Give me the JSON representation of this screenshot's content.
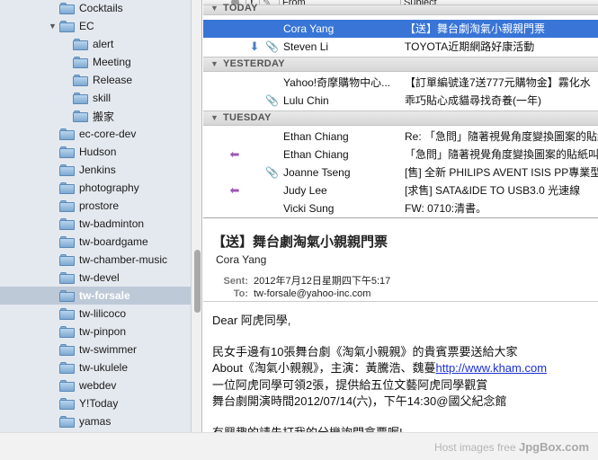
{
  "sidebar": {
    "folders": [
      {
        "label": "Cocktails"
      },
      {
        "label": "EC"
      },
      {
        "label": "alert"
      },
      {
        "label": "Meeting"
      },
      {
        "label": "Release"
      },
      {
        "label": "skill"
      },
      {
        "label": "搬家"
      },
      {
        "label": "ec-core-dev"
      },
      {
        "label": "Hudson"
      },
      {
        "label": "Jenkins"
      },
      {
        "label": "photography"
      },
      {
        "label": "prostore"
      },
      {
        "label": "tw-badminton"
      },
      {
        "label": "tw-boardgame"
      },
      {
        "label": "tw-chamber-music"
      },
      {
        "label": "tw-devel"
      },
      {
        "label": "tw-forsale"
      },
      {
        "label": "tw-lilicoco"
      },
      {
        "label": "tw-pinpon"
      },
      {
        "label": "tw-swimmer"
      },
      {
        "label": "tw-ukulele"
      },
      {
        "label": "webdev"
      },
      {
        "label": "Y!Today"
      },
      {
        "label": "yamas"
      }
    ]
  },
  "message_list": {
    "columns": {
      "from": "From",
      "subject": "Subject",
      "flag": "!"
    },
    "groups": [
      {
        "label": "TODAY"
      },
      {
        "label": "YESTERDAY"
      },
      {
        "label": "TUESDAY"
      }
    ],
    "rows": [
      {
        "from": "Cora Yang",
        "subject": "【送】舞台劇淘氣小親親門票"
      },
      {
        "from": "Steven Li",
        "subject": "TOYOTA近期網路好康活動"
      },
      {
        "from": "Yahoo!奇摩購物中心...",
        "subject": "【訂單編號逢7送777元購物金】霧化水"
      },
      {
        "from": "Lulu Chin",
        "subject": "乖巧貼心成貓尋找奇養(一年)"
      },
      {
        "from": "Ethan Chiang",
        "subject": "Re: 「急問」隨著視覺角度變換圖案的貼紙"
      },
      {
        "from": "Ethan Chiang",
        "subject": "「急問」隨著視覺角度變換圖案的貼紙叫"
      },
      {
        "from": "Joanne Tseng",
        "subject": "[售] 全新 PHILIPS AVENT ISIS PP專業型"
      },
      {
        "from": "Judy Lee",
        "subject": "[求售] SATA&IDE TO USB3.0 光速線"
      },
      {
        "from": "Vicki Sung",
        "subject": "FW: 0710:清書。"
      }
    ]
  },
  "preview": {
    "subject": "【送】舞台劇淘氣小親親門票",
    "from": "Cora Yang",
    "sent_label": "Sent:",
    "sent_value": "2012年7月12日星期四下午5:17",
    "to_label": "To:",
    "to_value": "tw-forsale@yahoo-inc.com",
    "body": {
      "greeting": "Dear 阿虎同學,",
      "line1": "民女手邊有10張舞台劇《淘氣小親親》的貴賓票要送給大家",
      "line2_prefix": "About《淘氣小親親》，主演：黃騰浩、魏蔓",
      "line2_link": "http://www.kham.com",
      "line3": "一位阿虎同學可領2張，提供給五位文藝阿虎同學觀賞",
      "line4": "舞台劇開演時間2012/07/14(六)，下午14:30@國父紀念館",
      "line5": "有興趣的請先打我的分機詢問拿票喔!"
    }
  },
  "footer": {
    "text": "Host images free",
    "brand": "JpgBox.com"
  },
  "colors": {
    "selection": "#3875d7",
    "sidebar_bg": "#e4e9ef",
    "sidebar_selected": "#bec9d8",
    "link": "#1b2fd6"
  }
}
